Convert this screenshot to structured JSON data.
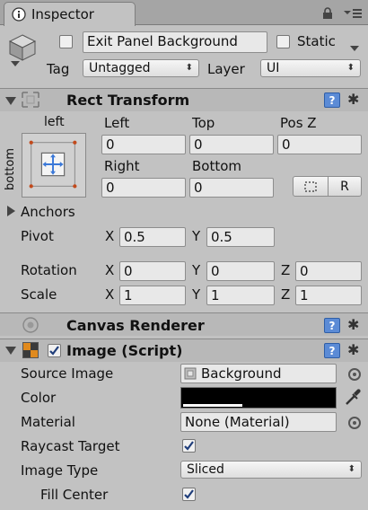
{
  "tab": {
    "title": "Inspector",
    "icon": "inspector-info-icon"
  },
  "gameobject": {
    "name": "Exit Panel Background",
    "static_label": "Static",
    "tag_label": "Tag",
    "tag_value": "Untagged",
    "layer_label": "Layer",
    "layer_value": "UI"
  },
  "rect_transform": {
    "title": "Rect Transform",
    "anchor_top_label": "left",
    "anchor_side_label": "bottom",
    "left_label": "Left",
    "left_value": "0",
    "top_label": "Top",
    "top_value": "0",
    "posz_label": "Pos Z",
    "posz_value": "0",
    "right_label": "Right",
    "right_value": "0",
    "bottom_label": "Bottom",
    "bottom_value": "0",
    "raw_button": "R",
    "anchors_label": "Anchors",
    "pivot_label": "Pivot",
    "pivot_x": "0.5",
    "pivot_y": "0.5",
    "rotation_label": "Rotation",
    "rotation_x": "0",
    "rotation_y": "0",
    "rotation_z": "0",
    "scale_label": "Scale",
    "scale_x": "1",
    "scale_y": "1",
    "scale_z": "1",
    "x_axis": "X",
    "y_axis": "Y",
    "z_axis": "Z"
  },
  "canvas_renderer": {
    "title": "Canvas Renderer"
  },
  "image": {
    "title": "Image (Script)",
    "source_image_label": "Source Image",
    "source_image_value": "Background",
    "color_label": "Color",
    "color_value": "#000000",
    "material_label": "Material",
    "material_value": "None (Material)",
    "raycast_label": "Raycast Target",
    "image_type_label": "Image Type",
    "image_type_value": "Sliced",
    "fill_center_label": "Fill Center"
  },
  "icons": {
    "help": "help-book-icon",
    "settings": "gear-icon",
    "help_glyph": "?",
    "gear_glyph": "✱"
  }
}
